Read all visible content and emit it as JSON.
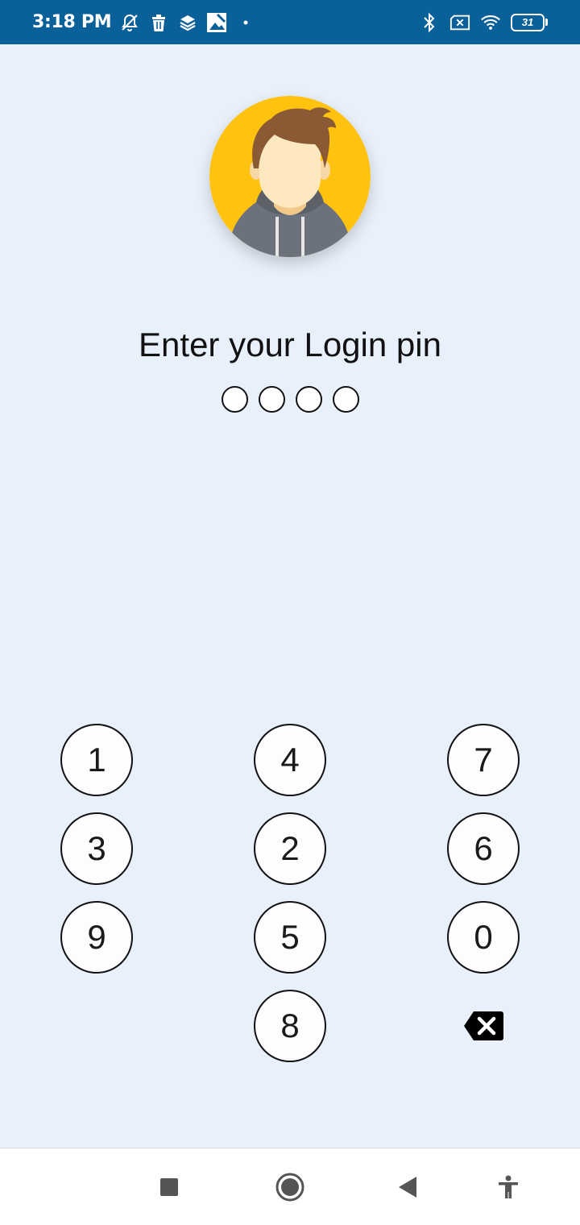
{
  "status_bar": {
    "time": "3:18 PM",
    "left_icons": [
      "notifications-muted-icon",
      "trash-icon",
      "layers-icon",
      "photo-icon",
      "dot-icon"
    ],
    "right_icons": [
      "bluetooth-icon",
      "no-sim-icon",
      "wifi-icon"
    ],
    "battery_level": "31"
  },
  "login": {
    "avatar_icon": "user-avatar-icon",
    "title": "Enter your Login pin",
    "pin_length": 4,
    "pin_filled": 0
  },
  "keypad": {
    "keys": [
      "1",
      "4",
      "7",
      "3",
      "2",
      "6",
      "9",
      "5",
      "0",
      "8"
    ],
    "backspace_icon": "backspace-icon"
  },
  "nav_bar": {
    "buttons": [
      "recents-square-icon",
      "home-circle-icon",
      "back-triangle-icon",
      "accessibility-icon"
    ]
  },
  "colors": {
    "status_bar": "#0a6098",
    "background": "#e8f0fb",
    "avatar_bg": "#ffc20e"
  }
}
